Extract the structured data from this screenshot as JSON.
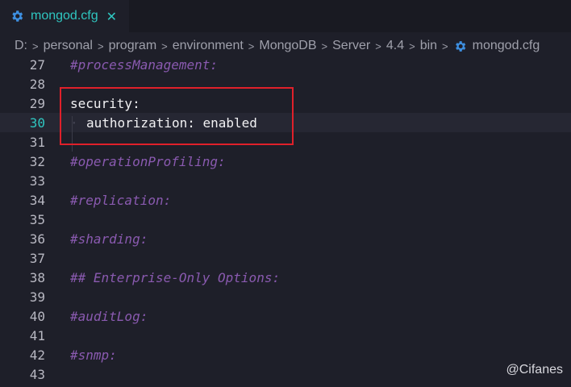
{
  "tab": {
    "filename": "mongod.cfg",
    "close_glyph": "✕",
    "icon": "gear-icon",
    "accent": "#2fc6c0"
  },
  "breadcrumb": {
    "items": [
      "D:",
      "personal",
      "program",
      "environment",
      "MongoDB",
      "Server",
      "4.4",
      "bin",
      "mongod.cfg"
    ],
    "separator": ">"
  },
  "editor": {
    "current_line": "30",
    "lines": [
      {
        "num": "27",
        "text": "#processManagement:"
      },
      {
        "num": "28",
        "text": ""
      },
      {
        "num": "29",
        "text": "security:"
      },
      {
        "num": "30",
        "text": "authorization: enabled"
      },
      {
        "num": "31",
        "text": ""
      },
      {
        "num": "32",
        "text": "#operationProfiling:"
      },
      {
        "num": "33",
        "text": ""
      },
      {
        "num": "34",
        "text": "#replication:"
      },
      {
        "num": "35",
        "text": ""
      },
      {
        "num": "36",
        "text": "#sharding:"
      },
      {
        "num": "37",
        "text": ""
      },
      {
        "num": "38",
        "text": "## Enterprise-Only Options:"
      },
      {
        "num": "39",
        "text": ""
      },
      {
        "num": "40",
        "text": "#auditLog:"
      },
      {
        "num": "41",
        "text": ""
      },
      {
        "num": "42",
        "text": "#snmp:"
      },
      {
        "num": "43",
        "text": ""
      }
    ]
  },
  "watermark": "@Cifanes",
  "colors": {
    "highlight_border": "#e0202a",
    "comment": "#8a5ab0",
    "background": "#1e1f29"
  }
}
